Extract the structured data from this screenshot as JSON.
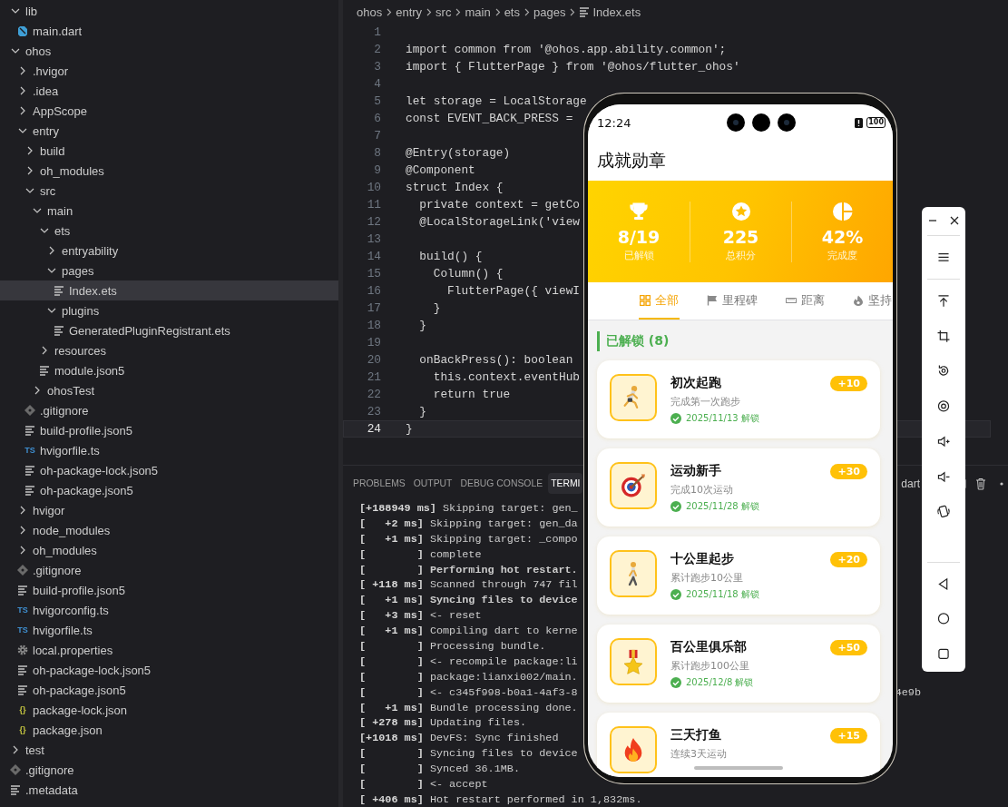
{
  "explorer": {
    "items": [
      {
        "name": "lib",
        "kind": "folder",
        "expanded": true,
        "selected": false,
        "children": [
          {
            "name": "main.dart",
            "kind": "dart",
            "selected": false
          }
        ]
      },
      {
        "name": "ohos",
        "kind": "folder",
        "expanded": true,
        "selected": false,
        "children": [
          {
            "name": ".hvigor",
            "kind": "folder",
            "expanded": false,
            "selected": false
          },
          {
            "name": ".idea",
            "kind": "folder",
            "expanded": false,
            "selected": false
          },
          {
            "name": "AppScope",
            "kind": "folder",
            "expanded": false,
            "selected": false
          },
          {
            "name": "entry",
            "kind": "folder",
            "expanded": true,
            "selected": false,
            "children": [
              {
                "name": "build",
                "kind": "folder",
                "expanded": false,
                "selected": false
              },
              {
                "name": "oh_modules",
                "kind": "folder",
                "expanded": false,
                "selected": false
              },
              {
                "name": "src",
                "kind": "folder",
                "expanded": true,
                "selected": false,
                "children": [
                  {
                    "name": "main",
                    "kind": "folder",
                    "expanded": true,
                    "selected": false,
                    "children": [
                      {
                        "name": "ets",
                        "kind": "folder",
                        "expanded": true,
                        "selected": false,
                        "children": [
                          {
                            "name": "entryability",
                            "kind": "folder",
                            "expanded": false,
                            "selected": false
                          },
                          {
                            "name": "pages",
                            "kind": "folder",
                            "expanded": true,
                            "selected": false,
                            "children": [
                              {
                                "name": "Index.ets",
                                "kind": "text",
                                "selected": true
                              }
                            ]
                          },
                          {
                            "name": "plugins",
                            "kind": "folder",
                            "expanded": true,
                            "selected": false,
                            "children": [
                              {
                                "name": "GeneratedPluginRegistrant.ets",
                                "kind": "text",
                                "selected": false
                              }
                            ]
                          }
                        ]
                      },
                      {
                        "name": "resources",
                        "kind": "folder",
                        "expanded": false,
                        "selected": false
                      },
                      {
                        "name": "module.json5",
                        "kind": "text",
                        "selected": false
                      }
                    ]
                  },
                  {
                    "name": "ohosTest",
                    "kind": "folder",
                    "expanded": false,
                    "selected": false
                  }
                ]
              },
              {
                "name": ".gitignore",
                "kind": "git",
                "selected": false
              },
              {
                "name": "build-profile.json5",
                "kind": "text",
                "selected": false
              },
              {
                "name": "hvigorfile.ts",
                "kind": "ts",
                "icon_text": "TS",
                "selected": false
              },
              {
                "name": "oh-package-lock.json5",
                "kind": "text",
                "selected": false
              },
              {
                "name": "oh-package.json5",
                "kind": "text",
                "selected": false
              }
            ]
          },
          {
            "name": "hvigor",
            "kind": "folder",
            "expanded": false,
            "selected": false
          },
          {
            "name": "node_modules",
            "kind": "folder",
            "expanded": false,
            "selected": false
          },
          {
            "name": "oh_modules",
            "kind": "folder",
            "expanded": false,
            "selected": false
          },
          {
            "name": ".gitignore",
            "kind": "git",
            "selected": false
          },
          {
            "name": "build-profile.json5",
            "kind": "text",
            "selected": false
          },
          {
            "name": "hvigorconfig.ts",
            "kind": "ts",
            "icon_text": "TS",
            "selected": false
          },
          {
            "name": "hvigorfile.ts",
            "kind": "ts",
            "icon_text": "TS",
            "selected": false
          },
          {
            "name": "local.properties",
            "kind": "gear",
            "selected": false
          },
          {
            "name": "oh-package-lock.json5",
            "kind": "text",
            "selected": false
          },
          {
            "name": "oh-package.json5",
            "kind": "text",
            "selected": false
          },
          {
            "name": "package-lock.json",
            "kind": "json",
            "icon_text": "{}",
            "selected": false
          },
          {
            "name": "package.json",
            "kind": "json",
            "icon_text": "{}",
            "selected": false
          }
        ]
      },
      {
        "name": "test",
        "kind": "folder",
        "expanded": false,
        "selected": false
      },
      {
        "name": ".gitignore",
        "kind": "git",
        "selected": false
      },
      {
        "name": ".metadata",
        "kind": "text",
        "selected": false
      }
    ]
  },
  "editor": {
    "breadcrumb": [
      "ohos",
      "entry",
      "src",
      "main",
      "ets",
      "pages",
      "Index.ets"
    ],
    "lines": [
      {
        "number": "1",
        "current": false
      },
      {
        "number": "2",
        "text": "import common from '@ohos.app.ability.common';",
        "current": false
      },
      {
        "number": "3",
        "text": "import { FlutterPage } from '@ohos/flutter_ohos'",
        "current": false
      },
      {
        "number": "4",
        "current": false
      },
      {
        "number": "5",
        "text": "let storage = LocalStorage",
        "current": false
      },
      {
        "number": "6",
        "text": "const EVENT_BACK_PRESS =",
        "current": false
      },
      {
        "number": "7",
        "current": false
      },
      {
        "number": "8",
        "text": "@Entry(storage)",
        "current": false
      },
      {
        "number": "9",
        "text": "@Component",
        "current": false
      },
      {
        "number": "10",
        "text": "struct Index {",
        "current": false
      },
      {
        "number": "11",
        "text": "  private context = getCo",
        "current": false
      },
      {
        "number": "12",
        "text": "  @LocalStorageLink('view",
        "current": false
      },
      {
        "number": "13",
        "current": false
      },
      {
        "number": "14",
        "text": "  build() {",
        "current": false
      },
      {
        "number": "15",
        "text": "    Column() {",
        "current": false
      },
      {
        "number": "16",
        "text": "      FlutterPage({ viewI",
        "current": false
      },
      {
        "number": "17",
        "text": "    }",
        "current": false
      },
      {
        "number": "18",
        "text": "  }",
        "current": false
      },
      {
        "number": "19",
        "current": false
      },
      {
        "number": "20",
        "text": "  onBackPress(): boolean",
        "current": false
      },
      {
        "number": "21",
        "text": "    this.context.eventHub",
        "current": false
      },
      {
        "number": "22",
        "text": "    return true",
        "current": false
      },
      {
        "number": "23",
        "text": "  }",
        "current": false
      },
      {
        "number": "24",
        "text": "}",
        "current": true
      }
    ]
  },
  "panel": {
    "tabs": [
      {
        "label": "PROBLEMS",
        "selected": false
      },
      {
        "label": "OUTPUT",
        "selected": false
      },
      {
        "label": "DEBUG CONSOLE",
        "selected": false
      },
      {
        "label": "TERMI",
        "selected": true
      }
    ],
    "terminal_name": "dart",
    "lines": [
      {
        "time": "[+188949 ms]",
        "text": "Skipping target: gen_",
        "bold": false
      },
      {
        "time": "[   +2 ms]",
        "text": "Skipping target: gen_da",
        "bold": false
      },
      {
        "time": "[   +1 ms]",
        "text": "Skipping target: _compo",
        "bold": false
      },
      {
        "time": "[        ]",
        "text": "complete",
        "bold": false
      },
      {
        "time": "[        ]",
        "text": "Performing hot restart.",
        "bold": true
      },
      {
        "time": "[ +118 ms]",
        "text": "Scanned through 747 fil",
        "bold": false
      },
      {
        "time": "[   +1 ms]",
        "text": "Syncing files to device",
        "bold": true
      },
      {
        "time": "[   +3 ms]",
        "text": "<- reset",
        "bold": false
      },
      {
        "time": "[   +1 ms]",
        "text": "Compiling dart to kerne",
        "bold": false
      },
      {
        "time": "[        ]",
        "text": "Processing bundle.",
        "bold": false
      },
      {
        "time": "[        ]",
        "text": "<- recompile package:li",
        "bold": false
      },
      {
        "time": "[        ]",
        "text": "package:lianxi002/main.",
        "bold": false
      },
      {
        "time": "[        ]",
        "text": "<- c345f998-b0a1-4af3-8",
        "tail": "4e9b",
        "bold": false
      },
      {
        "time": "[   +1 ms]",
        "text": "Bundle processing done.",
        "bold": false
      },
      {
        "time": "[ +278 ms]",
        "text": "Updating files.",
        "bold": false
      },
      {
        "time": "[+1018 ms]",
        "text": "DevFS: Sync finished",
        "bold": false
      },
      {
        "time": "[        ]",
        "text": "Syncing files to device",
        "bold": false
      },
      {
        "time": "[        ]",
        "text": "Synced 36.1MB.",
        "bold": false
      },
      {
        "time": "[        ]",
        "text": "<- accept",
        "bold": false
      },
      {
        "time": "[ +406 ms]",
        "text": "Hot restart performed in 1,832ms.",
        "bold": false
      }
    ]
  },
  "phone": {
    "status_bar": {
      "time": "12:24",
      "battery": "100"
    },
    "title": "成就勋章",
    "stats": [
      {
        "value": "8/19",
        "label": "已解锁"
      },
      {
        "value": "225",
        "label": "总积分"
      },
      {
        "value": "42%",
        "label": "完成度"
      }
    ],
    "tabs": [
      {
        "label": "全部",
        "selected": true
      },
      {
        "label": "里程碑",
        "selected": false
      },
      {
        "label": "距离",
        "selected": false
      },
      {
        "label": "坚持",
        "selected": false
      }
    ],
    "section": "已解锁 (8)",
    "cards": [
      {
        "title": "初次起跑",
        "description": "完成第一次跑步",
        "date": "2025/11/13 解锁",
        "points": "+10"
      },
      {
        "title": "运动新手",
        "description": "完成10次运动",
        "date": "2025/11/28 解锁",
        "points": "+30"
      },
      {
        "title": "十公里起步",
        "description": "累计跑步10公里",
        "date": "2025/11/18 解锁",
        "points": "+20"
      },
      {
        "title": "百公里俱乐部",
        "description": "累计跑步100公里",
        "date": "2025/12/8 解锁",
        "points": "+50"
      },
      {
        "title": "三天打鱼",
        "description": "连续3天运动",
        "points": "+15"
      }
    ]
  }
}
